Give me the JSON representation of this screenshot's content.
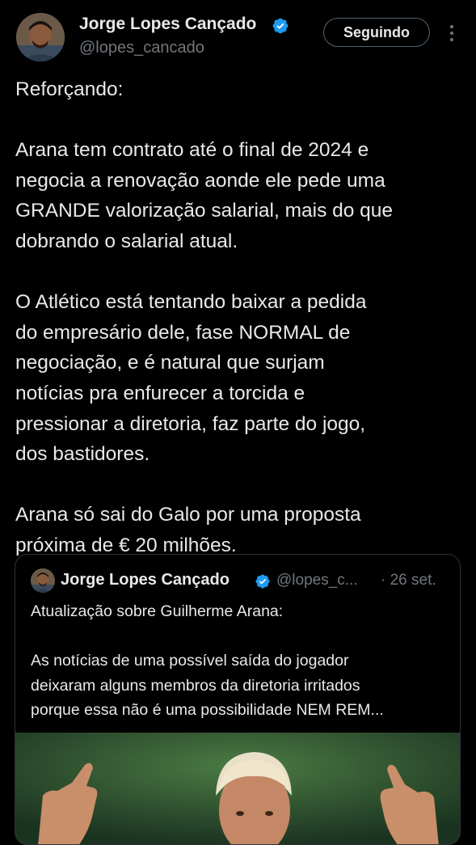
{
  "author": {
    "name": "Jorge Lopes Cançado",
    "handle": "@lopes_cancado",
    "follow_label": "Seguindo",
    "verified_color": "#1d9bf0"
  },
  "tweet": {
    "paragraphs": [
      [
        "Reforçando:"
      ],
      [
        "Arana tem contrato até o final de 2024 e",
        "negocia a renovação aonde ele pede uma",
        "GRANDE valorização salarial, mais do que",
        "dobrando o salarial atual."
      ],
      [
        "O Atlético está tentando baixar a pedida",
        "do empresário dele, fase NORMAL de",
        "negociação, e é natural que surjam",
        "notícias pra enfurecer a torcida e",
        "pressionar a diretoria, faz parte do jogo,",
        "dos bastidores."
      ],
      [
        "Arana só sai do Galo por uma proposta",
        "próxima de € 20 milhões."
      ]
    ]
  },
  "quote": {
    "name": "Jorge Lopes Cançado",
    "handle": "@lopes_c...",
    "date": "· 26 set.",
    "lines": [
      "Atualização sobre Guilherme Arana:",
      "",
      "As notícias de uma possível saída do jogador",
      "deixaram alguns membros da diretoria irritados",
      "porque essa não é uma possibilidade NEM REM..."
    ]
  },
  "icons": {
    "verified": "verified-badge-icon",
    "more": "more-options-icon"
  },
  "colors": {
    "background": "#000000",
    "text": "#e7e9ea",
    "secondary": "#71767b",
    "border": "#2f3336",
    "accent": "#1d9bf0"
  }
}
